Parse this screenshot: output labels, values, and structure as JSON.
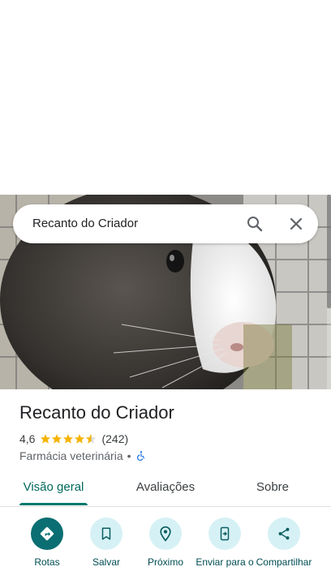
{
  "search": {
    "query": "Recanto do Criador",
    "search_icon": "search-icon",
    "close_icon": "close-icon"
  },
  "place": {
    "title": "Recanto do Criador",
    "rating": "4,6",
    "stars": 4.6,
    "review_count": "(242)",
    "category": "Farmácia veterinária",
    "separator": "•",
    "accessibility_icon": "wheelchair-icon"
  },
  "tabs": [
    {
      "label": "Visão geral",
      "active": true
    },
    {
      "label": "Avaliações",
      "active": false
    },
    {
      "label": "Sobre",
      "active": false
    }
  ],
  "actions": [
    {
      "label": "Rotas",
      "icon": "directions-icon"
    },
    {
      "label": "Salvar",
      "icon": "bookmark-icon"
    },
    {
      "label": "Próximo",
      "icon": "nearby-icon"
    },
    {
      "label": "Enviar para o",
      "icon": "send-to-phone-icon"
    },
    {
      "label": "Compartilhar",
      "icon": "share-icon"
    }
  ],
  "colors": {
    "accent": "#0b6e72",
    "accent_light": "#d6f1f5",
    "tab_active": "#00695c",
    "star": "#f4b400",
    "accessibility": "#1a73e8"
  }
}
